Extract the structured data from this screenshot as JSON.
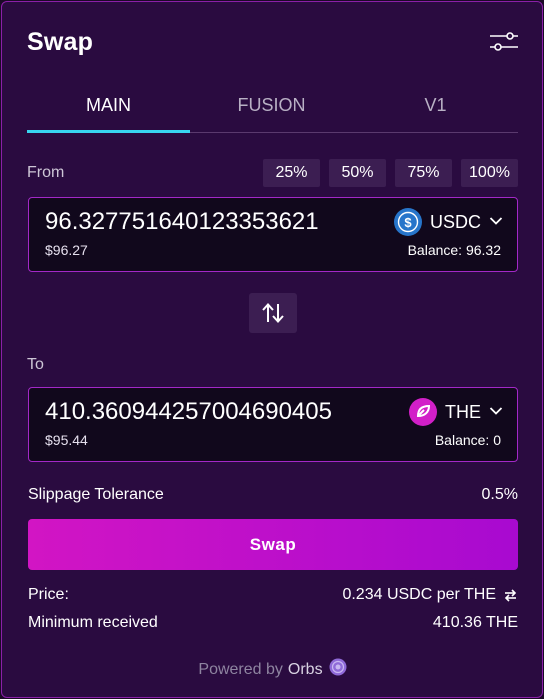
{
  "header": {
    "title": "Swap",
    "settings_icon": "sliders-icon"
  },
  "tabs": [
    {
      "label": "MAIN",
      "active": true
    },
    {
      "label": "FUSION",
      "active": false
    },
    {
      "label": "V1",
      "active": false
    }
  ],
  "from": {
    "label": "From",
    "percent_buttons": [
      "25%",
      "50%",
      "75%",
      "100%"
    ],
    "amount": "96.327751640123353621",
    "usd_value": "$96.27",
    "token": "USDC",
    "token_icon": "usdc-coin-icon",
    "balance": "Balance: 96.32"
  },
  "switch_icon": "swap-arrows-icon",
  "to": {
    "label": "To",
    "amount": "410.360944257004690405",
    "usd_value": "$95.44",
    "token": "THE",
    "token_icon": "the-coin-icon",
    "balance": "Balance: 0"
  },
  "slippage": {
    "label": "Slippage Tolerance",
    "value": "0.5%"
  },
  "swap_button": "Swap",
  "price": {
    "label": "Price:",
    "value": "0.234 USDC per THE"
  },
  "minimum": {
    "label": "Minimum received",
    "value": "410.36 THE"
  },
  "footer": {
    "prefix": "Powered by",
    "brand": "Orbs"
  },
  "colors": {
    "accent": "#38d6f0",
    "border": "#a328c8",
    "button_start": "#d215c4",
    "button_end": "#a80ad0",
    "usdc": "#2775ca",
    "the": "#d21fc8"
  }
}
